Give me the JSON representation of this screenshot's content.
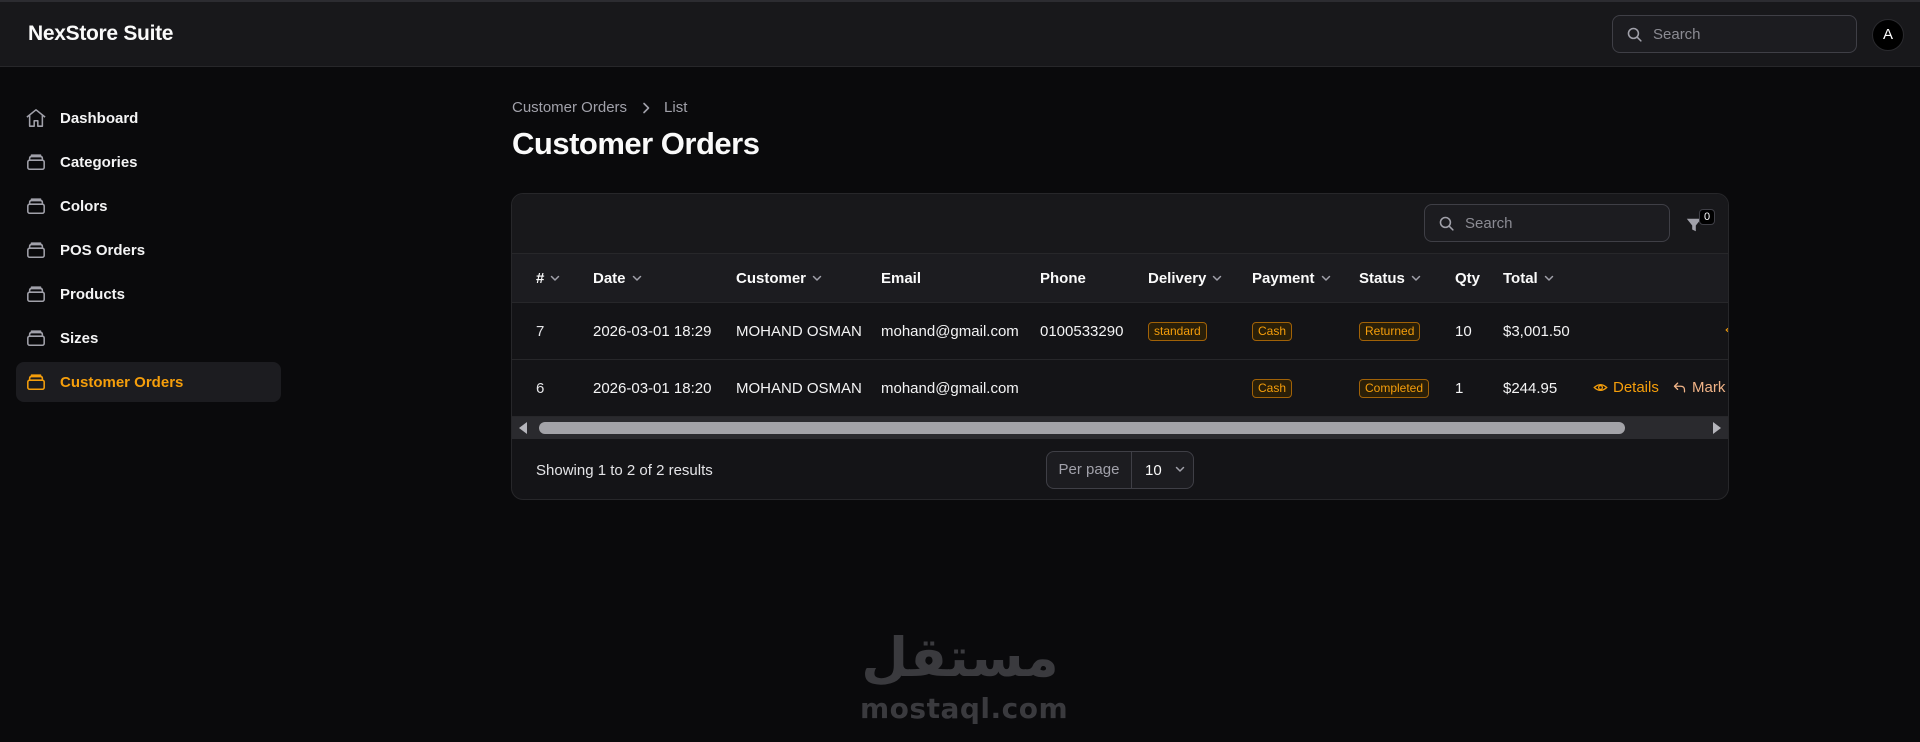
{
  "app": {
    "title": "NexStore Suite"
  },
  "topbar": {
    "search_placeholder": "Search",
    "avatar_initial": "A"
  },
  "sidebar": {
    "items": [
      {
        "label": "Dashboard",
        "icon": "home-icon",
        "active": false
      },
      {
        "label": "Categories",
        "icon": "stack-icon",
        "active": false
      },
      {
        "label": "Colors",
        "icon": "stack-icon",
        "active": false
      },
      {
        "label": "POS Orders",
        "icon": "stack-icon",
        "active": false
      },
      {
        "label": "Products",
        "icon": "stack-icon",
        "active": false
      },
      {
        "label": "Sizes",
        "icon": "stack-icon",
        "active": false
      },
      {
        "label": "Customer Orders",
        "icon": "stack-icon",
        "active": true
      }
    ]
  },
  "breadcrumb": {
    "parent": "Customer Orders",
    "current": "List"
  },
  "page": {
    "title": "Customer Orders"
  },
  "table": {
    "search_placeholder": "Search",
    "filter_count": "0",
    "columns": [
      {
        "label": "#",
        "sortable": true
      },
      {
        "label": "Date",
        "sortable": true
      },
      {
        "label": "Customer",
        "sortable": true
      },
      {
        "label": "Email",
        "sortable": false
      },
      {
        "label": "Phone",
        "sortable": false
      },
      {
        "label": "Delivery",
        "sortable": true
      },
      {
        "label": "Payment",
        "sortable": true
      },
      {
        "label": "Status",
        "sortable": true
      },
      {
        "label": "Qty",
        "sortable": false
      },
      {
        "label": "Total",
        "sortable": true
      }
    ],
    "rows": [
      {
        "id": "7",
        "date": "2026-03-01 18:29",
        "customer": "MOHAND OSMAN",
        "email": "mohand@gmail.com",
        "phone": "0100533290",
        "delivery": "standard",
        "payment": "Cash",
        "status": "Returned",
        "qty": "10",
        "total": "$3,001.50"
      },
      {
        "id": "6",
        "date": "2026-03-01 18:20",
        "customer": "MOHAND OSMAN",
        "email": "mohand@gmail.com",
        "phone": "",
        "delivery": "",
        "payment": "Cash",
        "status": "Completed",
        "qty": "1",
        "total": "$244.95",
        "actions": {
          "details": "Details",
          "mark": "Mark"
        }
      }
    ],
    "footer": {
      "summary": "Showing 1 to 2 of 2 results",
      "per_page_label": "Per page",
      "per_page_value": "10"
    }
  },
  "watermark": {
    "arabic": "مستقل",
    "latin": "mostaql.com"
  },
  "colors": {
    "accent": "#f59e0b",
    "background": "#0a0a0c",
    "panel": "#18181b"
  }
}
